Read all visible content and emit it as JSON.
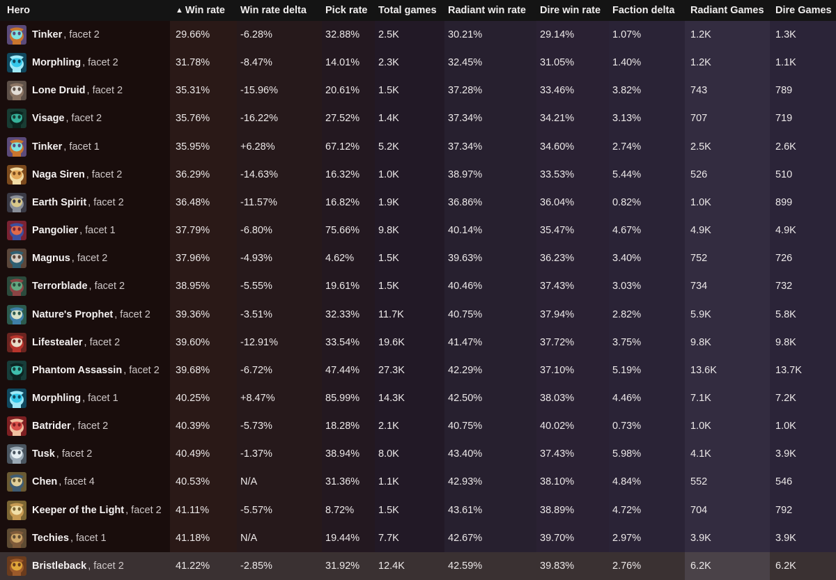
{
  "table": {
    "sort": {
      "column": "Win rate",
      "direction": "asc",
      "arrow_glyph": "▲"
    },
    "columns": [
      {
        "key": "hero",
        "label": "Hero"
      },
      {
        "key": "win_rate",
        "label": "Win rate",
        "sorted": true
      },
      {
        "key": "win_rate_delta",
        "label": "Win rate delta"
      },
      {
        "key": "pick_rate",
        "label": "Pick rate"
      },
      {
        "key": "total_games",
        "label": "Total games"
      },
      {
        "key": "radiant_win_rate",
        "label": "Radiant win rate"
      },
      {
        "key": "dire_win_rate",
        "label": "Dire win rate"
      },
      {
        "key": "faction_delta",
        "label": "Faction delta"
      },
      {
        "key": "radiant_games",
        "label": "Radiant Games",
        "highlighted": true
      },
      {
        "key": "dire_games",
        "label": "Dire Games"
      }
    ],
    "rows": [
      {
        "hero": "Tinker",
        "facet": ", facet 2",
        "icon": "tinker-icon",
        "win_rate": "29.66%",
        "win_rate_delta": "-6.28%",
        "pick_rate": "32.88%",
        "total_games": "2.5K",
        "radiant_win_rate": "30.21%",
        "dire_win_rate": "29.14%",
        "faction_delta": "1.07%",
        "radiant_games": "1.2K",
        "dire_games": "1.3K"
      },
      {
        "hero": "Morphling",
        "facet": ", facet 2",
        "icon": "morphling-icon",
        "win_rate": "31.78%",
        "win_rate_delta": "-8.47%",
        "pick_rate": "14.01%",
        "total_games": "2.3K",
        "radiant_win_rate": "32.45%",
        "dire_win_rate": "31.05%",
        "faction_delta": "1.40%",
        "radiant_games": "1.2K",
        "dire_games": "1.1K"
      },
      {
        "hero": "Lone Druid",
        "facet": ", facet 2",
        "icon": "lone-druid-icon",
        "win_rate": "35.31%",
        "win_rate_delta": "-15.96%",
        "pick_rate": "20.61%",
        "total_games": "1.5K",
        "radiant_win_rate": "37.28%",
        "dire_win_rate": "33.46%",
        "faction_delta": "3.82%",
        "radiant_games": "743",
        "dire_games": "789"
      },
      {
        "hero": "Visage",
        "facet": ", facet 2",
        "icon": "visage-icon",
        "win_rate": "35.76%",
        "win_rate_delta": "-16.22%",
        "pick_rate": "27.52%",
        "total_games": "1.4K",
        "radiant_win_rate": "37.34%",
        "dire_win_rate": "34.21%",
        "faction_delta": "3.13%",
        "radiant_games": "707",
        "dire_games": "719"
      },
      {
        "hero": "Tinker",
        "facet": ", facet 1",
        "icon": "tinker-icon",
        "win_rate": "35.95%",
        "win_rate_delta": "+6.28%",
        "pick_rate": "67.12%",
        "total_games": "5.2K",
        "radiant_win_rate": "37.34%",
        "dire_win_rate": "34.60%",
        "faction_delta": "2.74%",
        "radiant_games": "2.5K",
        "dire_games": "2.6K"
      },
      {
        "hero": "Naga Siren",
        "facet": ", facet 2",
        "icon": "naga-siren-icon",
        "win_rate": "36.29%",
        "win_rate_delta": "-14.63%",
        "pick_rate": "16.32%",
        "total_games": "1.0K",
        "radiant_win_rate": "38.97%",
        "dire_win_rate": "33.53%",
        "faction_delta": "5.44%",
        "radiant_games": "526",
        "dire_games": "510"
      },
      {
        "hero": "Earth Spirit",
        "facet": ", facet 2",
        "icon": "earth-spirit-icon",
        "win_rate": "36.48%",
        "win_rate_delta": "-11.57%",
        "pick_rate": "16.82%",
        "total_games": "1.9K",
        "radiant_win_rate": "36.86%",
        "dire_win_rate": "36.04%",
        "faction_delta": "0.82%",
        "radiant_games": "1.0K",
        "dire_games": "899"
      },
      {
        "hero": "Pangolier",
        "facet": ", facet 1",
        "icon": "pangolier-icon",
        "win_rate": "37.79%",
        "win_rate_delta": "-6.80%",
        "pick_rate": "75.66%",
        "total_games": "9.8K",
        "radiant_win_rate": "40.14%",
        "dire_win_rate": "35.47%",
        "faction_delta": "4.67%",
        "radiant_games": "4.9K",
        "dire_games": "4.9K"
      },
      {
        "hero": "Magnus",
        "facet": ", facet 2",
        "icon": "magnus-icon",
        "win_rate": "37.96%",
        "win_rate_delta": "-4.93%",
        "pick_rate": "4.62%",
        "total_games": "1.5K",
        "radiant_win_rate": "39.63%",
        "dire_win_rate": "36.23%",
        "faction_delta": "3.40%",
        "radiant_games": "752",
        "dire_games": "726"
      },
      {
        "hero": "Terrorblade",
        "facet": ", facet 2",
        "icon": "terrorblade-icon",
        "win_rate": "38.95%",
        "win_rate_delta": "-5.55%",
        "pick_rate": "19.61%",
        "total_games": "1.5K",
        "radiant_win_rate": "40.46%",
        "dire_win_rate": "37.43%",
        "faction_delta": "3.03%",
        "radiant_games": "734",
        "dire_games": "732"
      },
      {
        "hero": "Nature's Prophet",
        "facet": ", facet 2",
        "icon": "natures-prophet-icon",
        "win_rate": "39.36%",
        "win_rate_delta": "-3.51%",
        "pick_rate": "32.33%",
        "total_games": "11.7K",
        "radiant_win_rate": "40.75%",
        "dire_win_rate": "37.94%",
        "faction_delta": "2.82%",
        "radiant_games": "5.9K",
        "dire_games": "5.8K"
      },
      {
        "hero": "Lifestealer",
        "facet": ", facet 2",
        "icon": "lifestealer-icon",
        "win_rate": "39.60%",
        "win_rate_delta": "-12.91%",
        "pick_rate": "33.54%",
        "total_games": "19.6K",
        "radiant_win_rate": "41.47%",
        "dire_win_rate": "37.72%",
        "faction_delta": "3.75%",
        "radiant_games": "9.8K",
        "dire_games": "9.8K"
      },
      {
        "hero": "Phantom Assassin",
        "facet": ", facet 2",
        "icon": "phantom-assassin-icon",
        "win_rate": "39.68%",
        "win_rate_delta": "-6.72%",
        "pick_rate": "47.44%",
        "total_games": "27.3K",
        "radiant_win_rate": "42.29%",
        "dire_win_rate": "37.10%",
        "faction_delta": "5.19%",
        "radiant_games": "13.6K",
        "dire_games": "13.7K"
      },
      {
        "hero": "Morphling",
        "facet": ", facet 1",
        "icon": "morphling-icon",
        "win_rate": "40.25%",
        "win_rate_delta": "+8.47%",
        "pick_rate": "85.99%",
        "total_games": "14.3K",
        "radiant_win_rate": "42.50%",
        "dire_win_rate": "38.03%",
        "faction_delta": "4.46%",
        "radiant_games": "7.1K",
        "dire_games": "7.2K"
      },
      {
        "hero": "Batrider",
        "facet": ", facet 2",
        "icon": "batrider-icon",
        "win_rate": "40.39%",
        "win_rate_delta": "-5.73%",
        "pick_rate": "18.28%",
        "total_games": "2.1K",
        "radiant_win_rate": "40.75%",
        "dire_win_rate": "40.02%",
        "faction_delta": "0.73%",
        "radiant_games": "1.0K",
        "dire_games": "1.0K"
      },
      {
        "hero": "Tusk",
        "facet": ", facet 2",
        "icon": "tusk-icon",
        "win_rate": "40.49%",
        "win_rate_delta": "-1.37%",
        "pick_rate": "38.94%",
        "total_games": "8.0K",
        "radiant_win_rate": "43.40%",
        "dire_win_rate": "37.43%",
        "faction_delta": "5.98%",
        "radiant_games": "4.1K",
        "dire_games": "3.9K"
      },
      {
        "hero": "Chen",
        "facet": ", facet 4",
        "icon": "chen-icon",
        "win_rate": "40.53%",
        "win_rate_delta": "N/A",
        "pick_rate": "31.36%",
        "total_games": "1.1K",
        "radiant_win_rate": "42.93%",
        "dire_win_rate": "38.10%",
        "faction_delta": "4.84%",
        "radiant_games": "552",
        "dire_games": "546"
      },
      {
        "hero": "Keeper of the Light",
        "facet": ", facet 2",
        "icon": "keeper-of-the-light-icon",
        "win_rate": "41.11%",
        "win_rate_delta": "-5.57%",
        "pick_rate": "8.72%",
        "total_games": "1.5K",
        "radiant_win_rate": "43.61%",
        "dire_win_rate": "38.89%",
        "faction_delta": "4.72%",
        "radiant_games": "704",
        "dire_games": "792"
      },
      {
        "hero": "Techies",
        "facet": ", facet 1",
        "icon": "techies-icon",
        "win_rate": "41.18%",
        "win_rate_delta": "N/A",
        "pick_rate": "19.44%",
        "total_games": "7.7K",
        "radiant_win_rate": "42.67%",
        "dire_win_rate": "39.70%",
        "faction_delta": "2.97%",
        "radiant_games": "3.9K",
        "dire_games": "3.9K"
      },
      {
        "hero": "Bristleback",
        "facet": ", facet 2",
        "icon": "bristleback-icon",
        "hovered": true,
        "win_rate": "41.22%",
        "win_rate_delta": "-2.85%",
        "pick_rate": "31.92%",
        "total_games": "12.4K",
        "radiant_win_rate": "42.59%",
        "dire_win_rate": "39.83%",
        "faction_delta": "2.76%",
        "radiant_games": "6.2K",
        "dire_games": "6.2K"
      }
    ]
  },
  "colors": {
    "header_bg": "#141414",
    "hero_column_bg": "#190d0c",
    "highlight_column_bg": "#332c40",
    "hover_row_bg": "#3a3132",
    "text": "#ece8e8"
  }
}
